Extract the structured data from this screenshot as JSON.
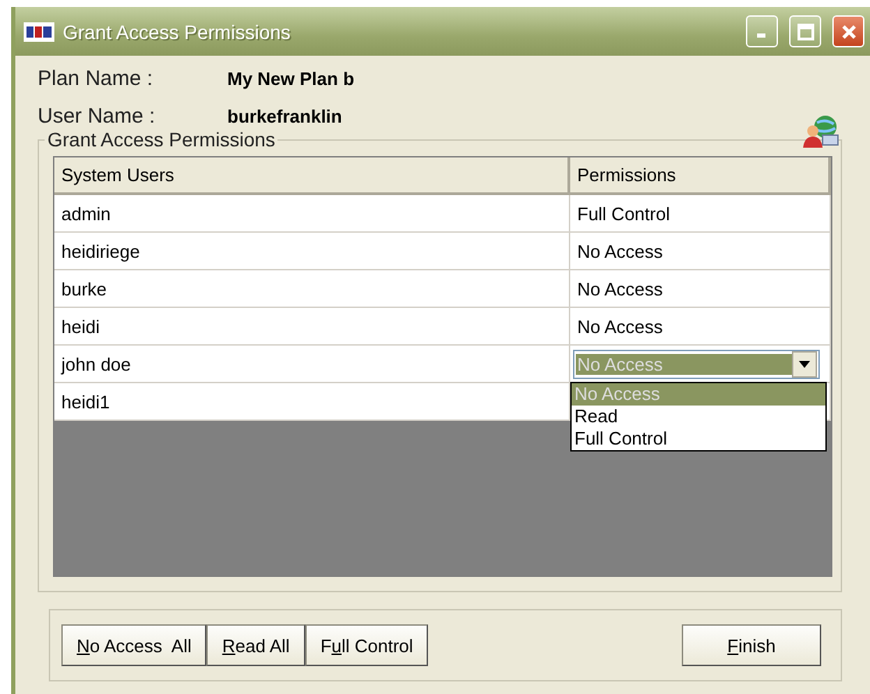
{
  "window": {
    "title": "Grant Access Permissions"
  },
  "info": [
    {
      "label": "Plan Name :",
      "value": "My New Plan b"
    },
    {
      "label": "User Name :",
      "value": "burkefranklin"
    }
  ],
  "group": {
    "title": "Grant Access Permissions"
  },
  "table": {
    "columns": [
      "System Users",
      "Permissions"
    ],
    "rows": [
      {
        "user": "admin",
        "kind": "text",
        "permission": "Full Control"
      },
      {
        "user": "heidiriege",
        "kind": "text",
        "permission": "No Access"
      },
      {
        "user": "burke",
        "kind": "text",
        "permission": "No Access"
      },
      {
        "user": "heidi",
        "kind": "text",
        "permission": "No Access"
      },
      {
        "user": "john doe",
        "kind": "combo",
        "permission": "No Access",
        "options": [
          {
            "label": "No Access",
            "selected": true
          },
          {
            "label": "Read",
            "selected": false
          },
          {
            "label": "Full Control",
            "selected": false
          }
        ]
      },
      {
        "user": "heidi1",
        "kind": "covered"
      }
    ]
  },
  "buttons": [
    {
      "key": "N",
      "after": "o Access  All"
    },
    {
      "key": "R",
      "after": "ead All"
    },
    {
      "before": "F",
      "key": "u",
      "after": "ll Control"
    }
  ],
  "finish_button": {
    "key": "F",
    "after": "inish"
  }
}
